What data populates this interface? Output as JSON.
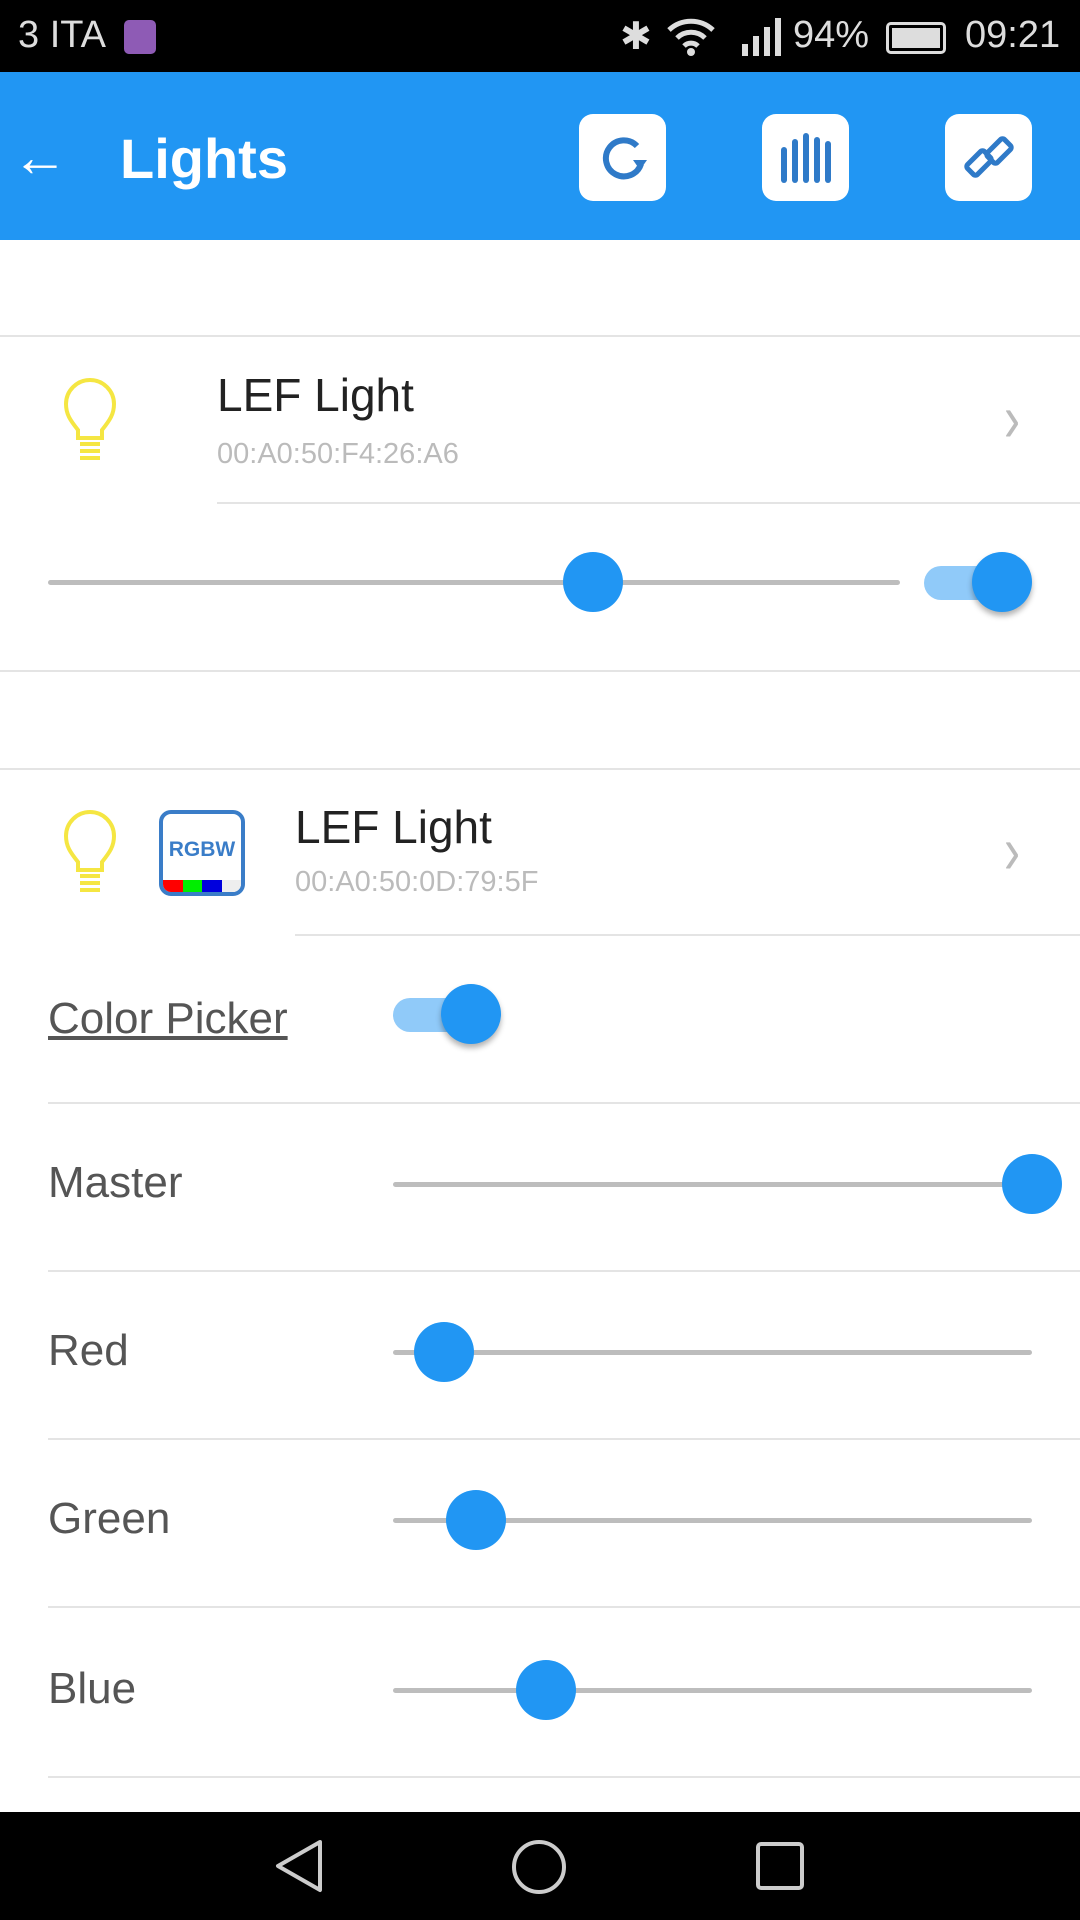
{
  "status_bar": {
    "carrier": "3 ITA",
    "battery": "94%",
    "time": "09:21"
  },
  "app_bar": {
    "title": "Lights",
    "buttons": [
      "refresh",
      "equalizer",
      "link"
    ]
  },
  "devices": [
    {
      "name": "LEF Light",
      "mac": "00:A0:50:F4:26:A6",
      "brightness_percent": 64,
      "on": true
    },
    {
      "name": "LEF Light",
      "mac": "00:A0:50:0D:79:5F",
      "badge": "RGBW",
      "color_picker_label": "Color Picker",
      "color_picker_on": true,
      "channels": [
        {
          "label": "Master",
          "value_percent": 100
        },
        {
          "label": "Red",
          "value_percent": 8
        },
        {
          "label": "Green",
          "value_percent": 13
        },
        {
          "label": "Blue",
          "value_percent": 24
        }
      ]
    }
  ],
  "colors": {
    "accent": "#2196f3",
    "bulb": "#f5e642"
  }
}
